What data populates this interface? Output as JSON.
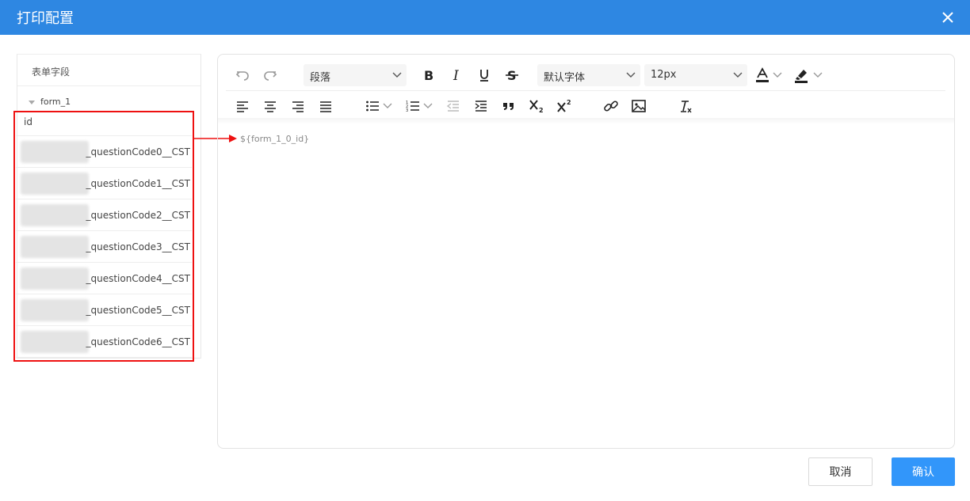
{
  "dialog": {
    "title": "打印配置"
  },
  "fields_panel": {
    "header": "表单字段",
    "tree_node": "form_1",
    "rows": [
      "id",
      "_questionCode0__CST",
      "_questionCode1__CST",
      "_questionCode2__CST",
      "_questionCode3__CST",
      "_questionCode4__CST",
      "_questionCode5__CST",
      "_questionCode6__CST"
    ]
  },
  "editor": {
    "paragraph_select": "段落",
    "font_select": "默认字体",
    "size_select": "12px",
    "content": "${form_1_0_id}"
  },
  "footer": {
    "cancel": "取消",
    "confirm": "确认"
  },
  "colors": {
    "titlebar": "#2e87e2",
    "primary_button": "#3296fa",
    "annotation": "#e11111"
  }
}
